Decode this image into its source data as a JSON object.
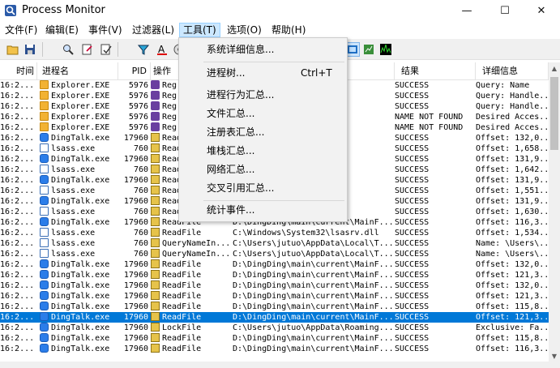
{
  "window": {
    "title": "Process Monitor",
    "controls": {
      "minimize": "—",
      "maximize": "☐",
      "close": "✕"
    }
  },
  "menubar": [
    {
      "label": "文件(F)",
      "active": false
    },
    {
      "label": "编辑(E)",
      "active": false
    },
    {
      "label": "事件(V)",
      "active": false
    },
    {
      "label": "过滤器(L)",
      "active": false
    },
    {
      "label": "工具(T)",
      "active": true
    },
    {
      "label": "选项(O)",
      "active": false
    },
    {
      "label": "帮助(H)",
      "active": false
    }
  ],
  "toolbar": {
    "buttons": [
      "open-icon",
      "save-icon",
      "find-icon",
      "jump-to-icon",
      "properties-icon",
      "filter-icon",
      "highlight-icon",
      "network-icon",
      "registry-activity-icon",
      "file-activity-icon",
      "process-activity-icon",
      "profiling-activity-icon"
    ]
  },
  "columns": [
    "时间",
    "进程名",
    "PID",
    "操作",
    "路径",
    "结果",
    "详细信息"
  ],
  "tools_menu": {
    "items": [
      {
        "label": "系统详细信息...",
        "shortcut": ""
      },
      {
        "label": "进程树...",
        "shortcut": "Ctrl+T"
      },
      {
        "label": "进程行为汇总...",
        "shortcut": ""
      },
      {
        "label": "文件汇总...",
        "shortcut": ""
      },
      {
        "label": "注册表汇总...",
        "shortcut": ""
      },
      {
        "label": "堆栈汇总...",
        "shortcut": ""
      },
      {
        "label": "网络汇总...",
        "shortcut": ""
      },
      {
        "label": "交叉引用汇总...",
        "shortcut": ""
      },
      {
        "label": "统计事件...",
        "shortcut": ""
      }
    ]
  },
  "rows": [
    {
      "time": "16:2...",
      "process": "Explorer.EXE",
      "icon": "explorer",
      "pid": "5976",
      "op": "Reg",
      "op_icon": "reg",
      "path": "",
      "result": "SUCCESS",
      "detail": "Query: Name"
    },
    {
      "time": "16:2...",
      "process": "Explorer.EXE",
      "icon": "explorer",
      "pid": "5976",
      "op": "Reg",
      "op_icon": "reg",
      "path": "",
      "result": "SUCCESS",
      "detail": "Query: Handle..."
    },
    {
      "time": "16:2...",
      "process": "Explorer.EXE",
      "icon": "explorer",
      "pid": "5976",
      "op": "Reg",
      "op_icon": "reg",
      "path": "",
      "result": "SUCCESS",
      "detail": "Query: Handle..."
    },
    {
      "time": "16:2...",
      "process": "Explorer.EXE",
      "icon": "explorer",
      "pid": "5976",
      "op": "Reg",
      "op_icon": "reg",
      "path": "",
      "result": "NAME NOT FOUND",
      "detail": "Desired Acces..."
    },
    {
      "time": "16:2...",
      "process": "Explorer.EXE",
      "icon": "explorer",
      "pid": "5976",
      "op": "Reg",
      "op_icon": "reg",
      "path": "",
      "result": "NAME NOT FOUND",
      "detail": "Desired Acces..."
    },
    {
      "time": "16:2...",
      "process": "DingTalk.exe",
      "icon": "dingtalk",
      "pid": "17960",
      "op": "ReadFile",
      "op_icon": "file",
      "path": "",
      "result": "SUCCESS",
      "detail": "Offset: 132,0..."
    },
    {
      "time": "16:2...",
      "process": "lsass.exe",
      "icon": "lsass",
      "pid": "760",
      "op": "ReadFile",
      "op_icon": "file",
      "path": "",
      "result": "SUCCESS",
      "detail": "Offset: 1,658..."
    },
    {
      "time": "16:2...",
      "process": "DingTalk.exe",
      "icon": "dingtalk",
      "pid": "17960",
      "op": "ReadFile",
      "op_icon": "file",
      "path": "",
      "result": "SUCCESS",
      "detail": "Offset: 131,9..."
    },
    {
      "time": "16:2...",
      "process": "lsass.exe",
      "icon": "lsass",
      "pid": "760",
      "op": "ReadFile",
      "op_icon": "file",
      "path": "",
      "result": "SUCCESS",
      "detail": "Offset: 1,642..."
    },
    {
      "time": "16:2...",
      "process": "DingTalk.exe",
      "icon": "dingtalk",
      "pid": "17960",
      "op": "ReadFile",
      "op_icon": "file",
      "path": "",
      "result": "SUCCESS",
      "detail": "Offset: 131,9..."
    },
    {
      "time": "16:2...",
      "process": "lsass.exe",
      "icon": "lsass",
      "pid": "760",
      "op": "ReadFile",
      "op_icon": "file",
      "path": "",
      "result": "SUCCESS",
      "detail": "Offset: 1,551..."
    },
    {
      "time": "16:2...",
      "process": "DingTalk.exe",
      "icon": "dingtalk",
      "pid": "17960",
      "op": "ReadFile",
      "op_icon": "file",
      "path": "",
      "result": "SUCCESS",
      "detail": "Offset: 131,9..."
    },
    {
      "time": "16:2...",
      "process": "lsass.exe",
      "icon": "lsass",
      "pid": "760",
      "op": "ReadFile",
      "op_icon": "file",
      "path": "",
      "result": "SUCCESS",
      "detail": "Offset: 1,630..."
    },
    {
      "time": "16:2...",
      "process": "DingTalk.exe",
      "icon": "dingtalk",
      "pid": "17960",
      "op": "ReadFile",
      "op_icon": "file",
      "path": "D:\\DingDing\\main\\current\\MainF...",
      "result": "SUCCESS",
      "detail": "Offset: 116,3..."
    },
    {
      "time": "16:2...",
      "process": "lsass.exe",
      "icon": "lsass",
      "pid": "760",
      "op": "ReadFile",
      "op_icon": "file",
      "path": "C:\\Windows\\System32\\lsasrv.dll",
      "result": "SUCCESS",
      "detail": "Offset: 1,534..."
    },
    {
      "time": "16:2...",
      "process": "lsass.exe",
      "icon": "lsass",
      "pid": "760",
      "op": "QueryNameIn...",
      "op_icon": "file",
      "path": "C:\\Users\\jutuo\\AppData\\Local\\T...",
      "result": "SUCCESS",
      "detail": "Name: \\Users\\..."
    },
    {
      "time": "16:2...",
      "process": "lsass.exe",
      "icon": "lsass",
      "pid": "760",
      "op": "QueryNameIn...",
      "op_icon": "file",
      "path": "C:\\Users\\jutuo\\AppData\\Local\\T...",
      "result": "SUCCESS",
      "detail": "Name: \\Users\\..."
    },
    {
      "time": "16:2...",
      "process": "DingTalk.exe",
      "icon": "dingtalk",
      "pid": "17960",
      "op": "ReadFile",
      "op_icon": "file",
      "path": "D:\\DingDing\\main\\current\\MainF...",
      "result": "SUCCESS",
      "detail": "Offset: 132,0..."
    },
    {
      "time": "16:2...",
      "process": "DingTalk.exe",
      "icon": "dingtalk",
      "pid": "17960",
      "op": "ReadFile",
      "op_icon": "file",
      "path": "D:\\DingDing\\main\\current\\MainF...",
      "result": "SUCCESS",
      "detail": "Offset: 121,3..."
    },
    {
      "time": "16:2...",
      "process": "DingTalk.exe",
      "icon": "dingtalk",
      "pid": "17960",
      "op": "ReadFile",
      "op_icon": "file",
      "path": "D:\\DingDing\\main\\current\\MainF...",
      "result": "SUCCESS",
      "detail": "Offset: 132,0..."
    },
    {
      "time": "16:2...",
      "process": "DingTalk.exe",
      "icon": "dingtalk",
      "pid": "17960",
      "op": "ReadFile",
      "op_icon": "file",
      "path": "D:\\DingDing\\main\\current\\MainF...",
      "result": "SUCCESS",
      "detail": "Offset: 121,3..."
    },
    {
      "time": "16:2...",
      "process": "DingTalk.exe",
      "icon": "dingtalk",
      "pid": "17960",
      "op": "ReadFile",
      "op_icon": "file",
      "path": "D:\\DingDing\\main\\current\\MainF...",
      "result": "SUCCESS",
      "detail": "Offset: 115,8..."
    },
    {
      "time": "16:2...",
      "process": "DingTalk.exe",
      "icon": "dingtalk",
      "pid": "17960",
      "op": "ReadFile",
      "op_icon": "file",
      "path": "D:\\DingDing\\main\\current\\MainF...",
      "result": "SUCCESS",
      "detail": "Offset: 121,3...",
      "selected": true
    },
    {
      "time": "16:2...",
      "process": "DingTalk.exe",
      "icon": "dingtalk",
      "pid": "17960",
      "op": "LockFile",
      "op_icon": "file",
      "path": "C:\\Users\\jutuo\\AppData\\Roaming...",
      "result": "SUCCESS",
      "detail": "Exclusive: Fa..."
    },
    {
      "time": "16:2...",
      "process": "DingTalk.exe",
      "icon": "dingtalk",
      "pid": "17960",
      "op": "ReadFile",
      "op_icon": "file",
      "path": "D:\\DingDing\\main\\current\\MainF...",
      "result": "SUCCESS",
      "detail": "Offset: 115,8..."
    },
    {
      "time": "16:2...",
      "process": "DingTalk.exe",
      "icon": "dingtalk",
      "pid": "17960",
      "op": "ReadFile",
      "op_icon": "file",
      "path": "D:\\DingDing\\main\\current\\MainF...",
      "result": "SUCCESS",
      "detail": "Offset: 116,3..."
    }
  ]
}
